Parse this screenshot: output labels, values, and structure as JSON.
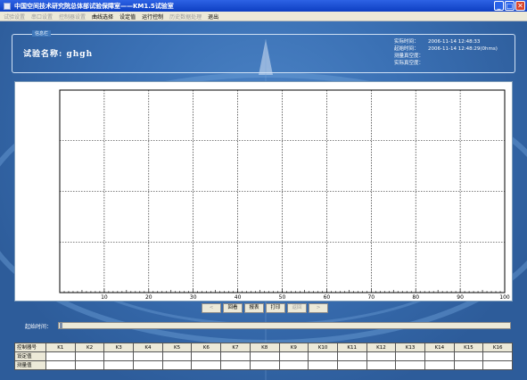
{
  "window": {
    "title": "中国空间技术研究院总体部试验保障室——KM1.5试验室",
    "buttons": {
      "minimize": "_",
      "maximize": "□",
      "close": "✕"
    }
  },
  "menu": [
    {
      "label": "试验设置",
      "enabled": false
    },
    {
      "label": "串口设置",
      "enabled": false
    },
    {
      "label": "控制器设置",
      "enabled": false
    },
    {
      "label": "曲线选择",
      "enabled": true
    },
    {
      "label": "设定值",
      "enabled": true
    },
    {
      "label": "运行控制",
      "enabled": true
    },
    {
      "label": "历史数据处理",
      "enabled": false
    },
    {
      "label": "退出",
      "enabled": true
    }
  ],
  "info": {
    "legend": "信息栏",
    "test_name_label": "试验名称:",
    "test_name_value": "ghgh",
    "rows": [
      {
        "label": "实际时间：",
        "value": "2006-11-14  12:48:33"
      },
      {
        "label": "起始时间：",
        "value": "2006-11-14  12:48:29(0hms)"
      },
      {
        "label": "测量真空度：",
        "value": ""
      },
      {
        "label": "实际真空度：",
        "value": ""
      }
    ]
  },
  "chart_data": {
    "type": "line",
    "series": [],
    "xlim": [
      0,
      100
    ],
    "x_ticks": [
      10,
      20,
      30,
      40,
      50,
      60,
      70,
      80,
      90,
      100
    ],
    "grid": true
  },
  "controls": {
    "prev": "<",
    "back": "回看",
    "report": "报表",
    "print": "打印",
    "return": "返回",
    "next": ">"
  },
  "start_time_label": "起始时间：",
  "start_time_fraction": 0.0,
  "table": {
    "row_labels": [
      "控制器号",
      "设定值",
      "测量值"
    ],
    "columns": [
      "K1",
      "K2",
      "K3",
      "K4",
      "K5",
      "K6",
      "K7",
      "K8",
      "K9",
      "K10",
      "K11",
      "K12",
      "K13",
      "K14",
      "K15",
      "K16"
    ]
  }
}
